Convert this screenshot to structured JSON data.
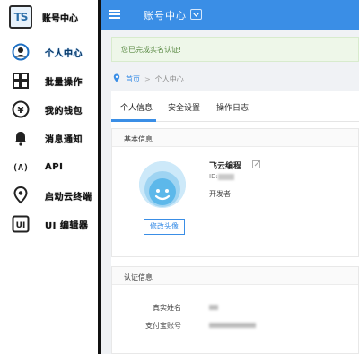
{
  "app": {
    "logo_text": "TS",
    "title": "账号中心"
  },
  "sidebar": {
    "items": [
      {
        "label": "个人中心",
        "icon": "user-circle-icon",
        "active": true
      },
      {
        "label": "批量操作",
        "icon": "grid-icon",
        "active": false
      },
      {
        "label": "我的钱包",
        "icon": "yen-coin-icon",
        "active": false
      },
      {
        "label": "消息通知",
        "icon": "bell-icon",
        "active": false
      },
      {
        "label": "API",
        "icon": "api-icon",
        "active": false
      },
      {
        "label": "启动云终端",
        "icon": "location-pin-icon",
        "active": false
      },
      {
        "label": "UI 编辑器",
        "icon": "ui-box-icon",
        "active": false
      }
    ]
  },
  "header": {
    "title": "账号中心",
    "accent": "#3a8ee6"
  },
  "notice": {
    "text": "您已完成实名认证!"
  },
  "breadcrumb": {
    "home": "首页",
    "separator": ">",
    "current": "个人中心"
  },
  "tabs": [
    {
      "label": "个人信息",
      "active": true
    },
    {
      "label": "安全设置",
      "active": false
    },
    {
      "label": "操作日志",
      "active": false
    }
  ],
  "basic_info": {
    "title": "基本信息",
    "name": "飞云编程",
    "id_prefix": "ID:",
    "role": "开发者",
    "edit_avatar_label": "修改头像"
  },
  "cert_info": {
    "title": "认证信息",
    "real_name_label": "真实姓名",
    "alipay_label": "支付宝账号"
  }
}
